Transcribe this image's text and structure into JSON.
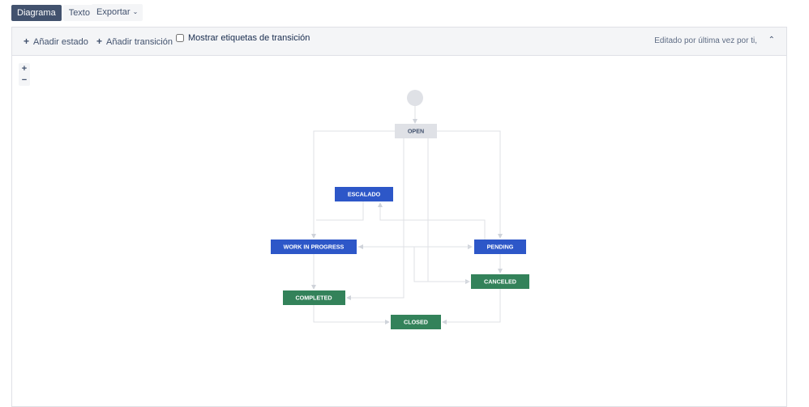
{
  "view_tabs": {
    "diagram": "Diagrama",
    "text": "Texto"
  },
  "export": {
    "label": "Exportar"
  },
  "toolbar": {
    "add_state": "Añadir estado",
    "add_transition": "Añadir transición",
    "show_labels": "Mostrar etiquetas de transición",
    "edited_by": "Editado por última vez por ti,"
  },
  "zoom": {
    "in": "+",
    "out": "−"
  },
  "colors": {
    "todo": "#dfe1e6",
    "in_progress": "#2d57c8",
    "done": "#33825a",
    "edge": "#dfe1e6",
    "toolbar_bg": "#f4f5f7"
  },
  "diagram": {
    "nodes": [
      {
        "id": "open",
        "label": "OPEN",
        "category": "todo"
      },
      {
        "id": "escalado",
        "label": "ESCALADO",
        "category": "in_progress"
      },
      {
        "id": "wip",
        "label": "WORK IN PROGRESS",
        "category": "in_progress"
      },
      {
        "id": "pending",
        "label": "PENDING",
        "category": "in_progress"
      },
      {
        "id": "canceled",
        "label": "CANCELED",
        "category": "done"
      },
      {
        "id": "completed",
        "label": "COMPLETED",
        "category": "done"
      },
      {
        "id": "closed",
        "label": "CLOSED",
        "category": "done"
      }
    ]
  }
}
